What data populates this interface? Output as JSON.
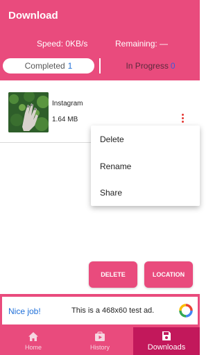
{
  "header": {
    "title": "Download",
    "speed": "Speed: 0KB/s",
    "remaining": "Remaining: —"
  },
  "tabs": [
    {
      "label": "Completed",
      "count": "1"
    },
    {
      "label": "In Progress",
      "count": "0"
    }
  ],
  "item": {
    "name": "Instagram",
    "size": "1.64 MB"
  },
  "menu": {
    "items": [
      "Delete",
      "Rename",
      "Share"
    ]
  },
  "buttons": {
    "delete": "DELETE",
    "location": "LOCATION"
  },
  "ad": {
    "nice": "Nice job!",
    "text": "This is a 468x60 test ad."
  },
  "nav": {
    "items": [
      {
        "label": "Home",
        "icon": "home-icon"
      },
      {
        "label": "History",
        "icon": "history-icon"
      },
      {
        "label": "Downloads",
        "icon": "downloads-icon"
      }
    ],
    "active": "Downloads"
  },
  "colors": {
    "primary": "#e94b7d",
    "nav_active": "#c2185b",
    "accent_blue": "#1e6fd9",
    "more_icon": "#e53935"
  }
}
